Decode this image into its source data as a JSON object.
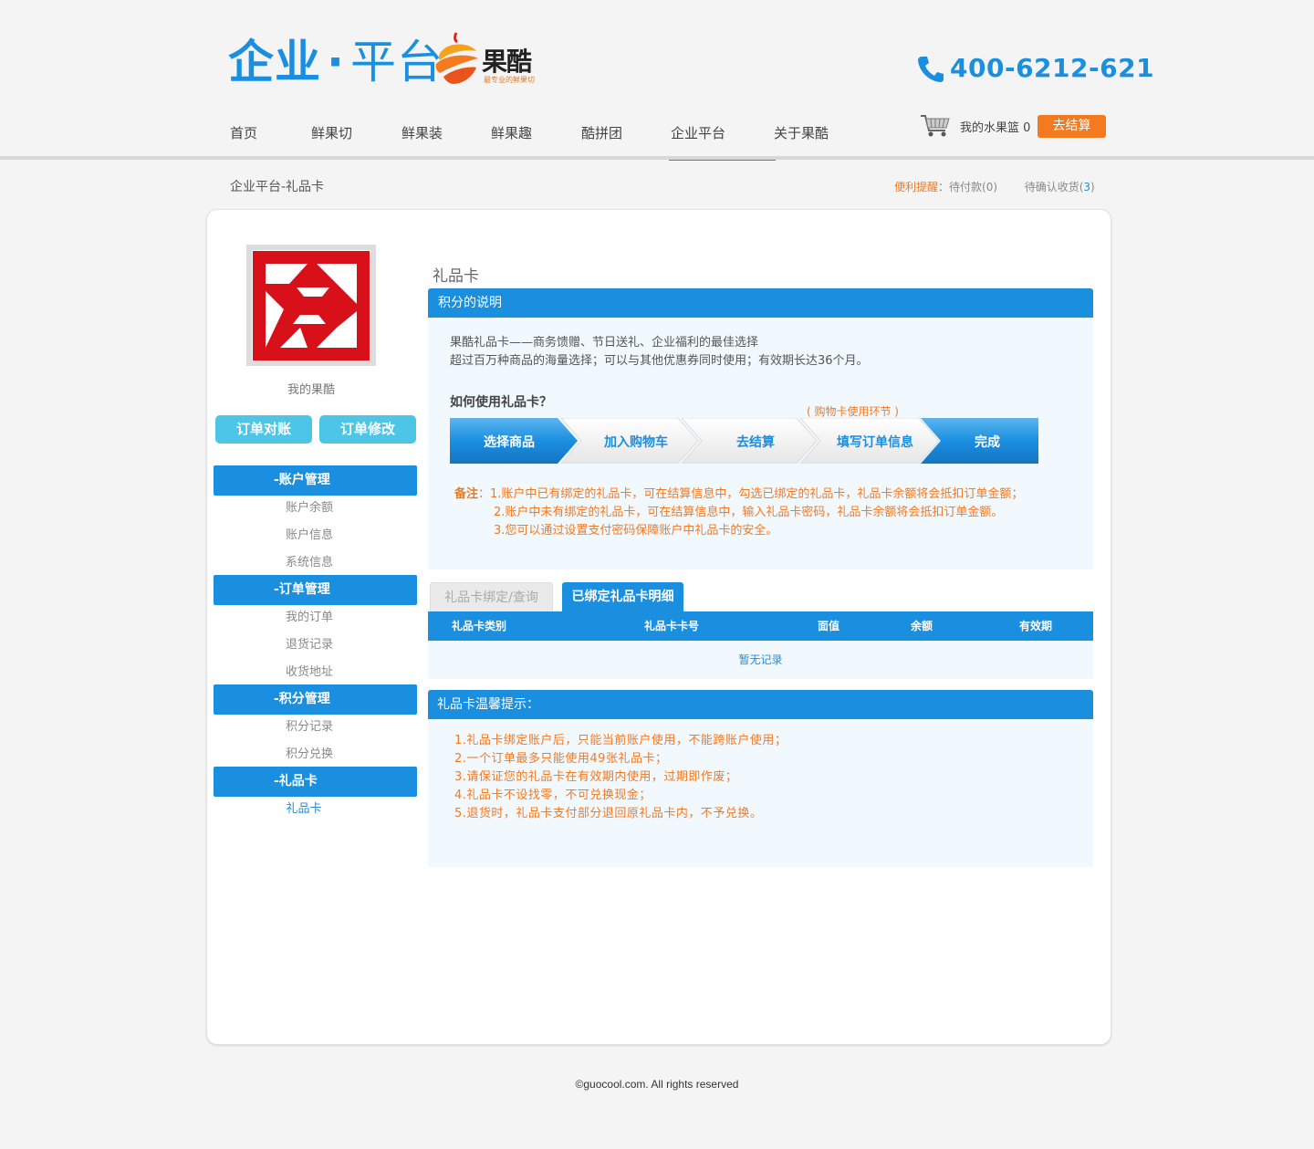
{
  "header": {
    "logo_part1": "企业",
    "logo_dot": "·",
    "logo_part2": "平台",
    "brand_name": "果酷",
    "brand_slogan": "最专业的鲜果切",
    "phone": "400-6212-621"
  },
  "nav": {
    "items": [
      "首页",
      "鲜果切",
      "鲜果装",
      "鲜果趣",
      "酷拼团",
      "企业平台",
      "关于果酷"
    ],
    "active_index": 5
  },
  "cart": {
    "label": "我的水果篮",
    "count": "0",
    "checkout": "去结算"
  },
  "breadcrumb": "企业平台-礼品卡",
  "reminder": {
    "label": "便利提醒",
    "colon": "：",
    "pending_pay": "待付款(0)",
    "pending_receive_prefix": "待确认收货(",
    "pending_receive_num": "3",
    "pending_receive_suffix": ")"
  },
  "sidebar": {
    "username": "我的果酷",
    "buttons": [
      "订单对账",
      "订单修改"
    ],
    "sections": [
      {
        "title": "-账户管理",
        "items": [
          "账户余额",
          "账户信息",
          "系统信息"
        ]
      },
      {
        "title": "-订单管理",
        "items": [
          "我的订单",
          "退货记录",
          "收货地址"
        ]
      },
      {
        "title": "-积分管理",
        "items": [
          "积分记录",
          "积分兑换"
        ]
      },
      {
        "title": "-礼品卡",
        "items": [
          "礼品卡"
        ]
      }
    ]
  },
  "content": {
    "title": "礼品卡",
    "explain_head": "积分的说明",
    "intro_line1": "果酷礼品卡——商务馈赠、节日送礼、企业福利的最佳选择",
    "intro_line2": "超过百万种商品的海量选择；可以与其他优惠券同时使用；有效期长达36个月。",
    "howto": "如何使用礼品卡？",
    "step_note": "( 购物卡使用环节 )",
    "steps": [
      "选择商品",
      "加入购物车",
      "去结算",
      "填写订单信息",
      "完成"
    ],
    "remark_label": "备注",
    "remark_colon": "：",
    "remarks": [
      "1.账户中已有绑定的礼品卡，可在结算信息中，勾选已绑定的礼品卡，礼品卡余额将会抵扣订单金额；",
      "2.账户中未有绑定的礼品卡，可在结算信息中，输入礼品卡密码，礼品卡余额将会抵扣订单金额。",
      "3.您可以通过设置支付密码保障账户中礼品卡的安全。"
    ],
    "tabs": [
      "礼品卡绑定/查询",
      "已绑定礼品卡明细"
    ],
    "table_headers": [
      "礼品卡类别",
      "礼品卡卡号",
      "面值",
      "余额",
      "有效期"
    ],
    "empty": "暂无记录",
    "tips_head": "礼品卡温馨提示：",
    "tips": [
      "1.礼品卡绑定账户后，只能当前账户使用，不能跨账户使用；",
      "2.一个订单最多只能使用49张礼品卡；",
      "3.请保证您的礼品卡在有效期内使用，过期即作废；",
      "4.礼品卡不设找零，不可兑换现金；",
      "5.退货时，礼品卡支付部分退回原礼品卡内，不予兑换。"
    ]
  },
  "footer": "©guocool.com. All rights reserved",
  "colors": {
    "primary": "#1a8fe0",
    "orange": "#f47a1f",
    "cyan_button": "#4cc5e6",
    "avatar_red": "#d7101a"
  },
  "icons": [
    "phone-icon",
    "cart-icon",
    "brand-orange-icon"
  ]
}
